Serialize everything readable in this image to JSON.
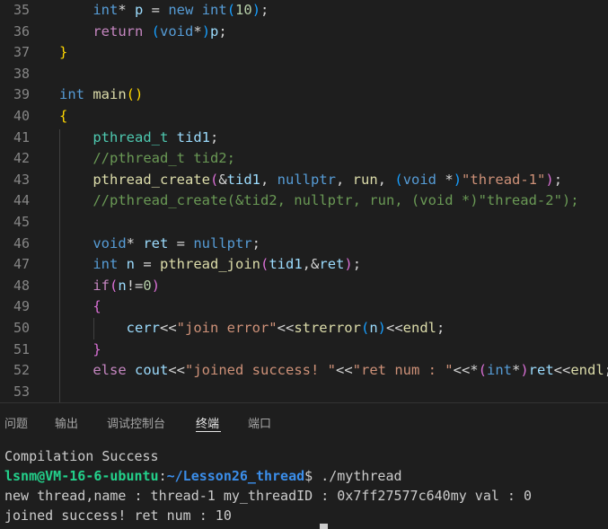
{
  "editor": {
    "lines": [
      {
        "num": "35",
        "tokens": [
          {
            "t": "    "
          },
          {
            "t": "int",
            "c": "kw"
          },
          {
            "t": "* "
          },
          {
            "t": "p",
            "c": "var"
          },
          {
            "t": " = "
          },
          {
            "t": "new",
            "c": "kw"
          },
          {
            "t": " "
          },
          {
            "t": "int",
            "c": "kw"
          },
          {
            "t": "(",
            "c": "br3"
          },
          {
            "t": "10",
            "c": "num"
          },
          {
            "t": ")",
            "c": "br3"
          },
          {
            "t": ";"
          }
        ]
      },
      {
        "num": "36",
        "tokens": [
          {
            "t": "    "
          },
          {
            "t": "return",
            "c": "cf"
          },
          {
            "t": " "
          },
          {
            "t": "(",
            "c": "br3"
          },
          {
            "t": "void",
            "c": "kw"
          },
          {
            "t": "*"
          },
          {
            "t": ")",
            "c": "br3"
          },
          {
            "t": "p",
            "c": "var"
          },
          {
            "t": ";"
          }
        ]
      },
      {
        "num": "37",
        "tokens": [
          {
            "t": "}",
            "c": "br1"
          }
        ]
      },
      {
        "num": "38",
        "tokens": []
      },
      {
        "num": "39",
        "tokens": [
          {
            "t": "int",
            "c": "kw"
          },
          {
            "t": " "
          },
          {
            "t": "main",
            "c": "fn"
          },
          {
            "t": "()",
            "c": "br1"
          }
        ]
      },
      {
        "num": "40",
        "tokens": [
          {
            "t": "{",
            "c": "br1"
          }
        ]
      },
      {
        "num": "41",
        "tokens": [
          {
            "t": "    "
          },
          {
            "t": "pthread_t",
            "c": "ty"
          },
          {
            "t": " "
          },
          {
            "t": "tid1",
            "c": "var"
          },
          {
            "t": ";"
          }
        ]
      },
      {
        "num": "42",
        "tokens": [
          {
            "t": "    "
          },
          {
            "t": "//pthread_t tid2;",
            "c": "cm"
          }
        ]
      },
      {
        "num": "43",
        "tokens": [
          {
            "t": "    "
          },
          {
            "t": "pthread_create",
            "c": "fn"
          },
          {
            "t": "(",
            "c": "br2"
          },
          {
            "t": "&"
          },
          {
            "t": "tid1",
            "c": "var"
          },
          {
            "t": ", "
          },
          {
            "t": "nullptr",
            "c": "kw"
          },
          {
            "t": ", "
          },
          {
            "t": "run",
            "c": "fn"
          },
          {
            "t": ", "
          },
          {
            "t": "(",
            "c": "br3"
          },
          {
            "t": "void",
            "c": "kw"
          },
          {
            "t": " *"
          },
          {
            "t": ")",
            "c": "br3"
          },
          {
            "t": "\"thread-1\"",
            "c": "str"
          },
          {
            "t": ")",
            "c": "br2"
          },
          {
            "t": ";"
          }
        ]
      },
      {
        "num": "44",
        "tokens": [
          {
            "t": "    "
          },
          {
            "t": "//pthread_create(&tid2, nullptr, run, (void *)\"thread-2\");",
            "c": "cm"
          }
        ]
      },
      {
        "num": "45",
        "tokens": []
      },
      {
        "num": "46",
        "tokens": [
          {
            "t": "    "
          },
          {
            "t": "void",
            "c": "kw"
          },
          {
            "t": "* "
          },
          {
            "t": "ret",
            "c": "var"
          },
          {
            "t": " = "
          },
          {
            "t": "nullptr",
            "c": "kw"
          },
          {
            "t": ";"
          }
        ]
      },
      {
        "num": "47",
        "tokens": [
          {
            "t": "    "
          },
          {
            "t": "int",
            "c": "kw"
          },
          {
            "t": " "
          },
          {
            "t": "n",
            "c": "var"
          },
          {
            "t": " = "
          },
          {
            "t": "pthread_join",
            "c": "fn"
          },
          {
            "t": "(",
            "c": "br2"
          },
          {
            "t": "tid1",
            "c": "var"
          },
          {
            "t": ","
          },
          {
            "t": "&"
          },
          {
            "t": "ret",
            "c": "var"
          },
          {
            "t": ")",
            "c": "br2"
          },
          {
            "t": ";"
          }
        ]
      },
      {
        "num": "48",
        "tokens": [
          {
            "t": "    "
          },
          {
            "t": "if",
            "c": "cf"
          },
          {
            "t": "(",
            "c": "br2"
          },
          {
            "t": "n",
            "c": "var"
          },
          {
            "t": "!="
          },
          {
            "t": "0",
            "c": "num"
          },
          {
            "t": ")",
            "c": "br2"
          }
        ]
      },
      {
        "num": "49",
        "tokens": [
          {
            "t": "    "
          },
          {
            "t": "{",
            "c": "br2"
          }
        ]
      },
      {
        "num": "50",
        "tokens": [
          {
            "t": "        "
          },
          {
            "t": "cerr",
            "c": "var"
          },
          {
            "t": "<<"
          },
          {
            "t": "\"join error\"",
            "c": "str"
          },
          {
            "t": "<<"
          },
          {
            "t": "strerror",
            "c": "fn"
          },
          {
            "t": "(",
            "c": "br3"
          },
          {
            "t": "n",
            "c": "var"
          },
          {
            "t": ")",
            "c": "br3"
          },
          {
            "t": "<<"
          },
          {
            "t": "endl",
            "c": "fn"
          },
          {
            "t": ";"
          }
        ]
      },
      {
        "num": "51",
        "tokens": [
          {
            "t": "    "
          },
          {
            "t": "}",
            "c": "br2"
          }
        ]
      },
      {
        "num": "52",
        "tokens": [
          {
            "t": "    "
          },
          {
            "t": "else",
            "c": "cf"
          },
          {
            "t": " "
          },
          {
            "t": "cout",
            "c": "var"
          },
          {
            "t": "<<"
          },
          {
            "t": "\"joined success! \"",
            "c": "str"
          },
          {
            "t": "<<"
          },
          {
            "t": "\"ret num : \"",
            "c": "str"
          },
          {
            "t": "<<*"
          },
          {
            "t": "(",
            "c": "br2"
          },
          {
            "t": "int",
            "c": "kw"
          },
          {
            "t": "*"
          },
          {
            "t": ")",
            "c": "br2"
          },
          {
            "t": "ret",
            "c": "var"
          },
          {
            "t": "<<"
          },
          {
            "t": "endl",
            "c": "fn"
          },
          {
            "t": ";"
          }
        ]
      },
      {
        "num": "53",
        "tokens": []
      }
    ]
  },
  "panel": {
    "tabs": [
      {
        "label": "问题",
        "active": false
      },
      {
        "label": "输出",
        "active": false
      },
      {
        "label": "调试控制台",
        "active": false
      },
      {
        "label": "终端",
        "active": true
      },
      {
        "label": "端口",
        "active": false
      }
    ]
  },
  "terminal": {
    "compile_status": "Compilation Success",
    "prompt_user": "lsnm@VM-16-6-ubuntu",
    "prompt_sep": ":",
    "prompt_path": "~/Lesson26_thread",
    "prompt_symbol": "$ ",
    "command": "./mythread",
    "output_line_1": "new thread,name : thread-1 my_threadID : 0x7ff27577c640my val : 0",
    "output_line_2": "joined success! ret num : 10"
  },
  "colors": {
    "editor_bg": "#1e1e1e",
    "keyword": "#569cd6",
    "control": "#c586c0",
    "function": "#dcdcaa",
    "type": "#4ec9b0",
    "variable": "#9cdcfe",
    "number": "#b5cea8",
    "string": "#ce9178",
    "comment": "#6a9955",
    "prompt_user": "#23d18b",
    "prompt_path": "#3b8eea"
  }
}
